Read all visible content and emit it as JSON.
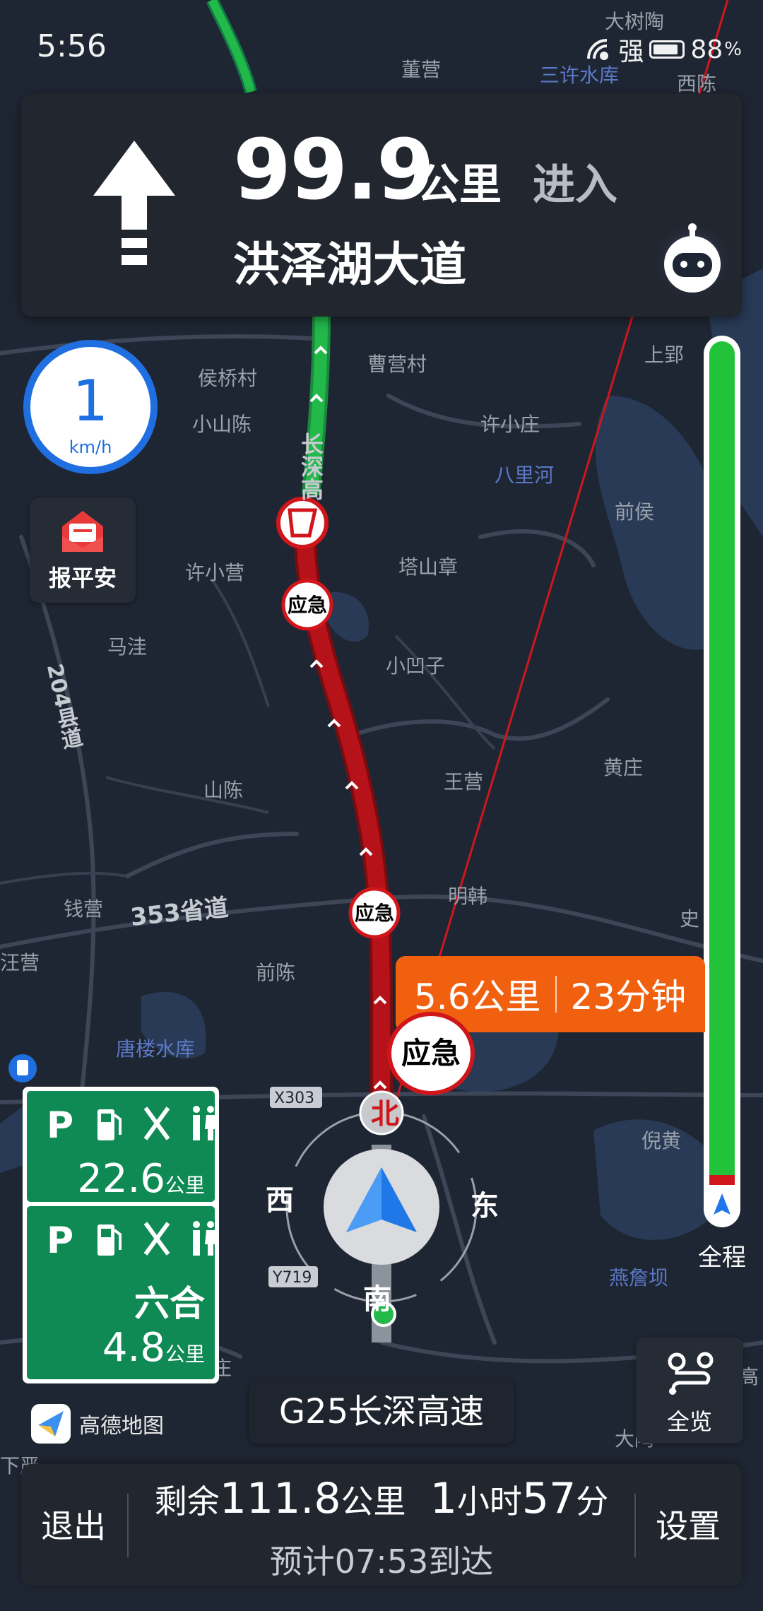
{
  "status": {
    "time": "5:56",
    "signal": "强",
    "battery": "88",
    "battery_unit": "%"
  },
  "guidance": {
    "distance": "99.9",
    "unit": "公里",
    "action": "进入",
    "road": "洪泽湖大道"
  },
  "speed": {
    "value": "1",
    "unit": "km/h"
  },
  "safety_button": {
    "label": "报平安"
  },
  "progress": {
    "label": "全程",
    "completed_fraction": 0.04
  },
  "route_segment": {
    "distance": "5.6公里",
    "time": "23分钟"
  },
  "service_areas": [
    {
      "name": "",
      "distance": "22.6",
      "unit": "公里"
    },
    {
      "name": "六合",
      "distance": "4.8",
      "unit": "公里"
    }
  ],
  "compass": {
    "north": "北",
    "south": "南",
    "east": "东",
    "west": "西"
  },
  "current_road": "G25长深高速",
  "overview_button": {
    "label": "全览"
  },
  "brand": "高德地图",
  "bottom": {
    "exit": "退出",
    "settings": "设置",
    "remaining_prefix": "剩余",
    "remaining_distance": "111.8",
    "remaining_distance_unit": "公里",
    "remaining_hours": "1",
    "hours_unit": "小时",
    "remaining_minutes": "57",
    "minutes_unit": "分",
    "eta": "预计07:53到达"
  },
  "map_labels": {
    "top": [
      "董营",
      "三许水库",
      "西陈",
      "大树陶"
    ],
    "places": [
      "侯桥村",
      "曹营村",
      "小山陈",
      "许小庄",
      "八里河",
      "前侯",
      "上郢",
      "许小营",
      "塔山章",
      "马洼",
      "小凹子",
      "王营",
      "黄庄",
      "山陈",
      "明韩",
      "钱营",
      "前陈",
      "汪营",
      "史",
      "唐楼水库",
      "倪黄",
      "燕詹坝",
      "大陶",
      "高",
      "下严",
      "庄"
    ],
    "roads": [
      "长深高",
      "204县道",
      "353省道",
      "X303",
      "Y719"
    ],
    "incident": "应急"
  },
  "colors": {
    "route_red": "#b5121a",
    "route_green": "#22b84a",
    "accent_blue": "#1f6fe0",
    "orange": "#f0600f",
    "service_green": "#0f8a55"
  }
}
